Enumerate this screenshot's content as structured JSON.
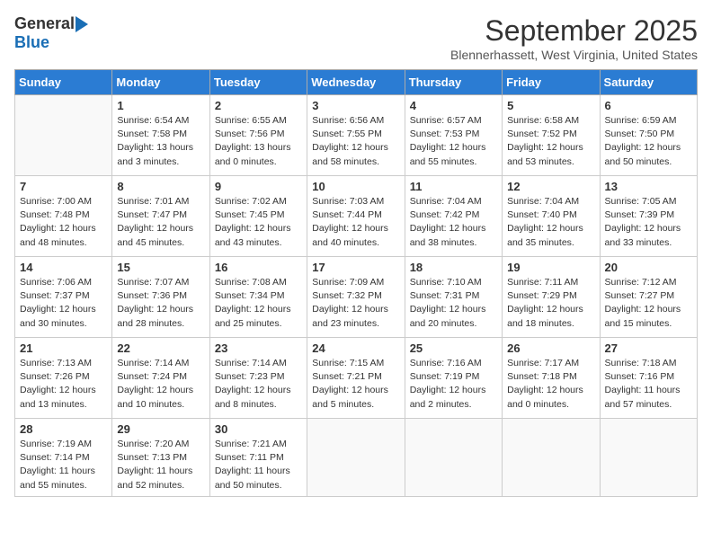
{
  "logo": {
    "general": "General",
    "blue": "Blue"
  },
  "title": "September 2025",
  "location": "Blennerhassett, West Virginia, United States",
  "weekdays": [
    "Sunday",
    "Monday",
    "Tuesday",
    "Wednesday",
    "Thursday",
    "Friday",
    "Saturday"
  ],
  "weeks": [
    [
      {
        "day": "",
        "info": ""
      },
      {
        "day": "1",
        "info": "Sunrise: 6:54 AM\nSunset: 7:58 PM\nDaylight: 13 hours\nand 3 minutes."
      },
      {
        "day": "2",
        "info": "Sunrise: 6:55 AM\nSunset: 7:56 PM\nDaylight: 13 hours\nand 0 minutes."
      },
      {
        "day": "3",
        "info": "Sunrise: 6:56 AM\nSunset: 7:55 PM\nDaylight: 12 hours\nand 58 minutes."
      },
      {
        "day": "4",
        "info": "Sunrise: 6:57 AM\nSunset: 7:53 PM\nDaylight: 12 hours\nand 55 minutes."
      },
      {
        "day": "5",
        "info": "Sunrise: 6:58 AM\nSunset: 7:52 PM\nDaylight: 12 hours\nand 53 minutes."
      },
      {
        "day": "6",
        "info": "Sunrise: 6:59 AM\nSunset: 7:50 PM\nDaylight: 12 hours\nand 50 minutes."
      }
    ],
    [
      {
        "day": "7",
        "info": "Sunrise: 7:00 AM\nSunset: 7:48 PM\nDaylight: 12 hours\nand 48 minutes."
      },
      {
        "day": "8",
        "info": "Sunrise: 7:01 AM\nSunset: 7:47 PM\nDaylight: 12 hours\nand 45 minutes."
      },
      {
        "day": "9",
        "info": "Sunrise: 7:02 AM\nSunset: 7:45 PM\nDaylight: 12 hours\nand 43 minutes."
      },
      {
        "day": "10",
        "info": "Sunrise: 7:03 AM\nSunset: 7:44 PM\nDaylight: 12 hours\nand 40 minutes."
      },
      {
        "day": "11",
        "info": "Sunrise: 7:04 AM\nSunset: 7:42 PM\nDaylight: 12 hours\nand 38 minutes."
      },
      {
        "day": "12",
        "info": "Sunrise: 7:04 AM\nSunset: 7:40 PM\nDaylight: 12 hours\nand 35 minutes."
      },
      {
        "day": "13",
        "info": "Sunrise: 7:05 AM\nSunset: 7:39 PM\nDaylight: 12 hours\nand 33 minutes."
      }
    ],
    [
      {
        "day": "14",
        "info": "Sunrise: 7:06 AM\nSunset: 7:37 PM\nDaylight: 12 hours\nand 30 minutes."
      },
      {
        "day": "15",
        "info": "Sunrise: 7:07 AM\nSunset: 7:36 PM\nDaylight: 12 hours\nand 28 minutes."
      },
      {
        "day": "16",
        "info": "Sunrise: 7:08 AM\nSunset: 7:34 PM\nDaylight: 12 hours\nand 25 minutes."
      },
      {
        "day": "17",
        "info": "Sunrise: 7:09 AM\nSunset: 7:32 PM\nDaylight: 12 hours\nand 23 minutes."
      },
      {
        "day": "18",
        "info": "Sunrise: 7:10 AM\nSunset: 7:31 PM\nDaylight: 12 hours\nand 20 minutes."
      },
      {
        "day": "19",
        "info": "Sunrise: 7:11 AM\nSunset: 7:29 PM\nDaylight: 12 hours\nand 18 minutes."
      },
      {
        "day": "20",
        "info": "Sunrise: 7:12 AM\nSunset: 7:27 PM\nDaylight: 12 hours\nand 15 minutes."
      }
    ],
    [
      {
        "day": "21",
        "info": "Sunrise: 7:13 AM\nSunset: 7:26 PM\nDaylight: 12 hours\nand 13 minutes."
      },
      {
        "day": "22",
        "info": "Sunrise: 7:14 AM\nSunset: 7:24 PM\nDaylight: 12 hours\nand 10 minutes."
      },
      {
        "day": "23",
        "info": "Sunrise: 7:14 AM\nSunset: 7:23 PM\nDaylight: 12 hours\nand 8 minutes."
      },
      {
        "day": "24",
        "info": "Sunrise: 7:15 AM\nSunset: 7:21 PM\nDaylight: 12 hours\nand 5 minutes."
      },
      {
        "day": "25",
        "info": "Sunrise: 7:16 AM\nSunset: 7:19 PM\nDaylight: 12 hours\nand 2 minutes."
      },
      {
        "day": "26",
        "info": "Sunrise: 7:17 AM\nSunset: 7:18 PM\nDaylight: 12 hours\nand 0 minutes."
      },
      {
        "day": "27",
        "info": "Sunrise: 7:18 AM\nSunset: 7:16 PM\nDaylight: 11 hours\nand 57 minutes."
      }
    ],
    [
      {
        "day": "28",
        "info": "Sunrise: 7:19 AM\nSunset: 7:14 PM\nDaylight: 11 hours\nand 55 minutes."
      },
      {
        "day": "29",
        "info": "Sunrise: 7:20 AM\nSunset: 7:13 PM\nDaylight: 11 hours\nand 52 minutes."
      },
      {
        "day": "30",
        "info": "Sunrise: 7:21 AM\nSunset: 7:11 PM\nDaylight: 11 hours\nand 50 minutes."
      },
      {
        "day": "",
        "info": ""
      },
      {
        "day": "",
        "info": ""
      },
      {
        "day": "",
        "info": ""
      },
      {
        "day": "",
        "info": ""
      }
    ]
  ]
}
